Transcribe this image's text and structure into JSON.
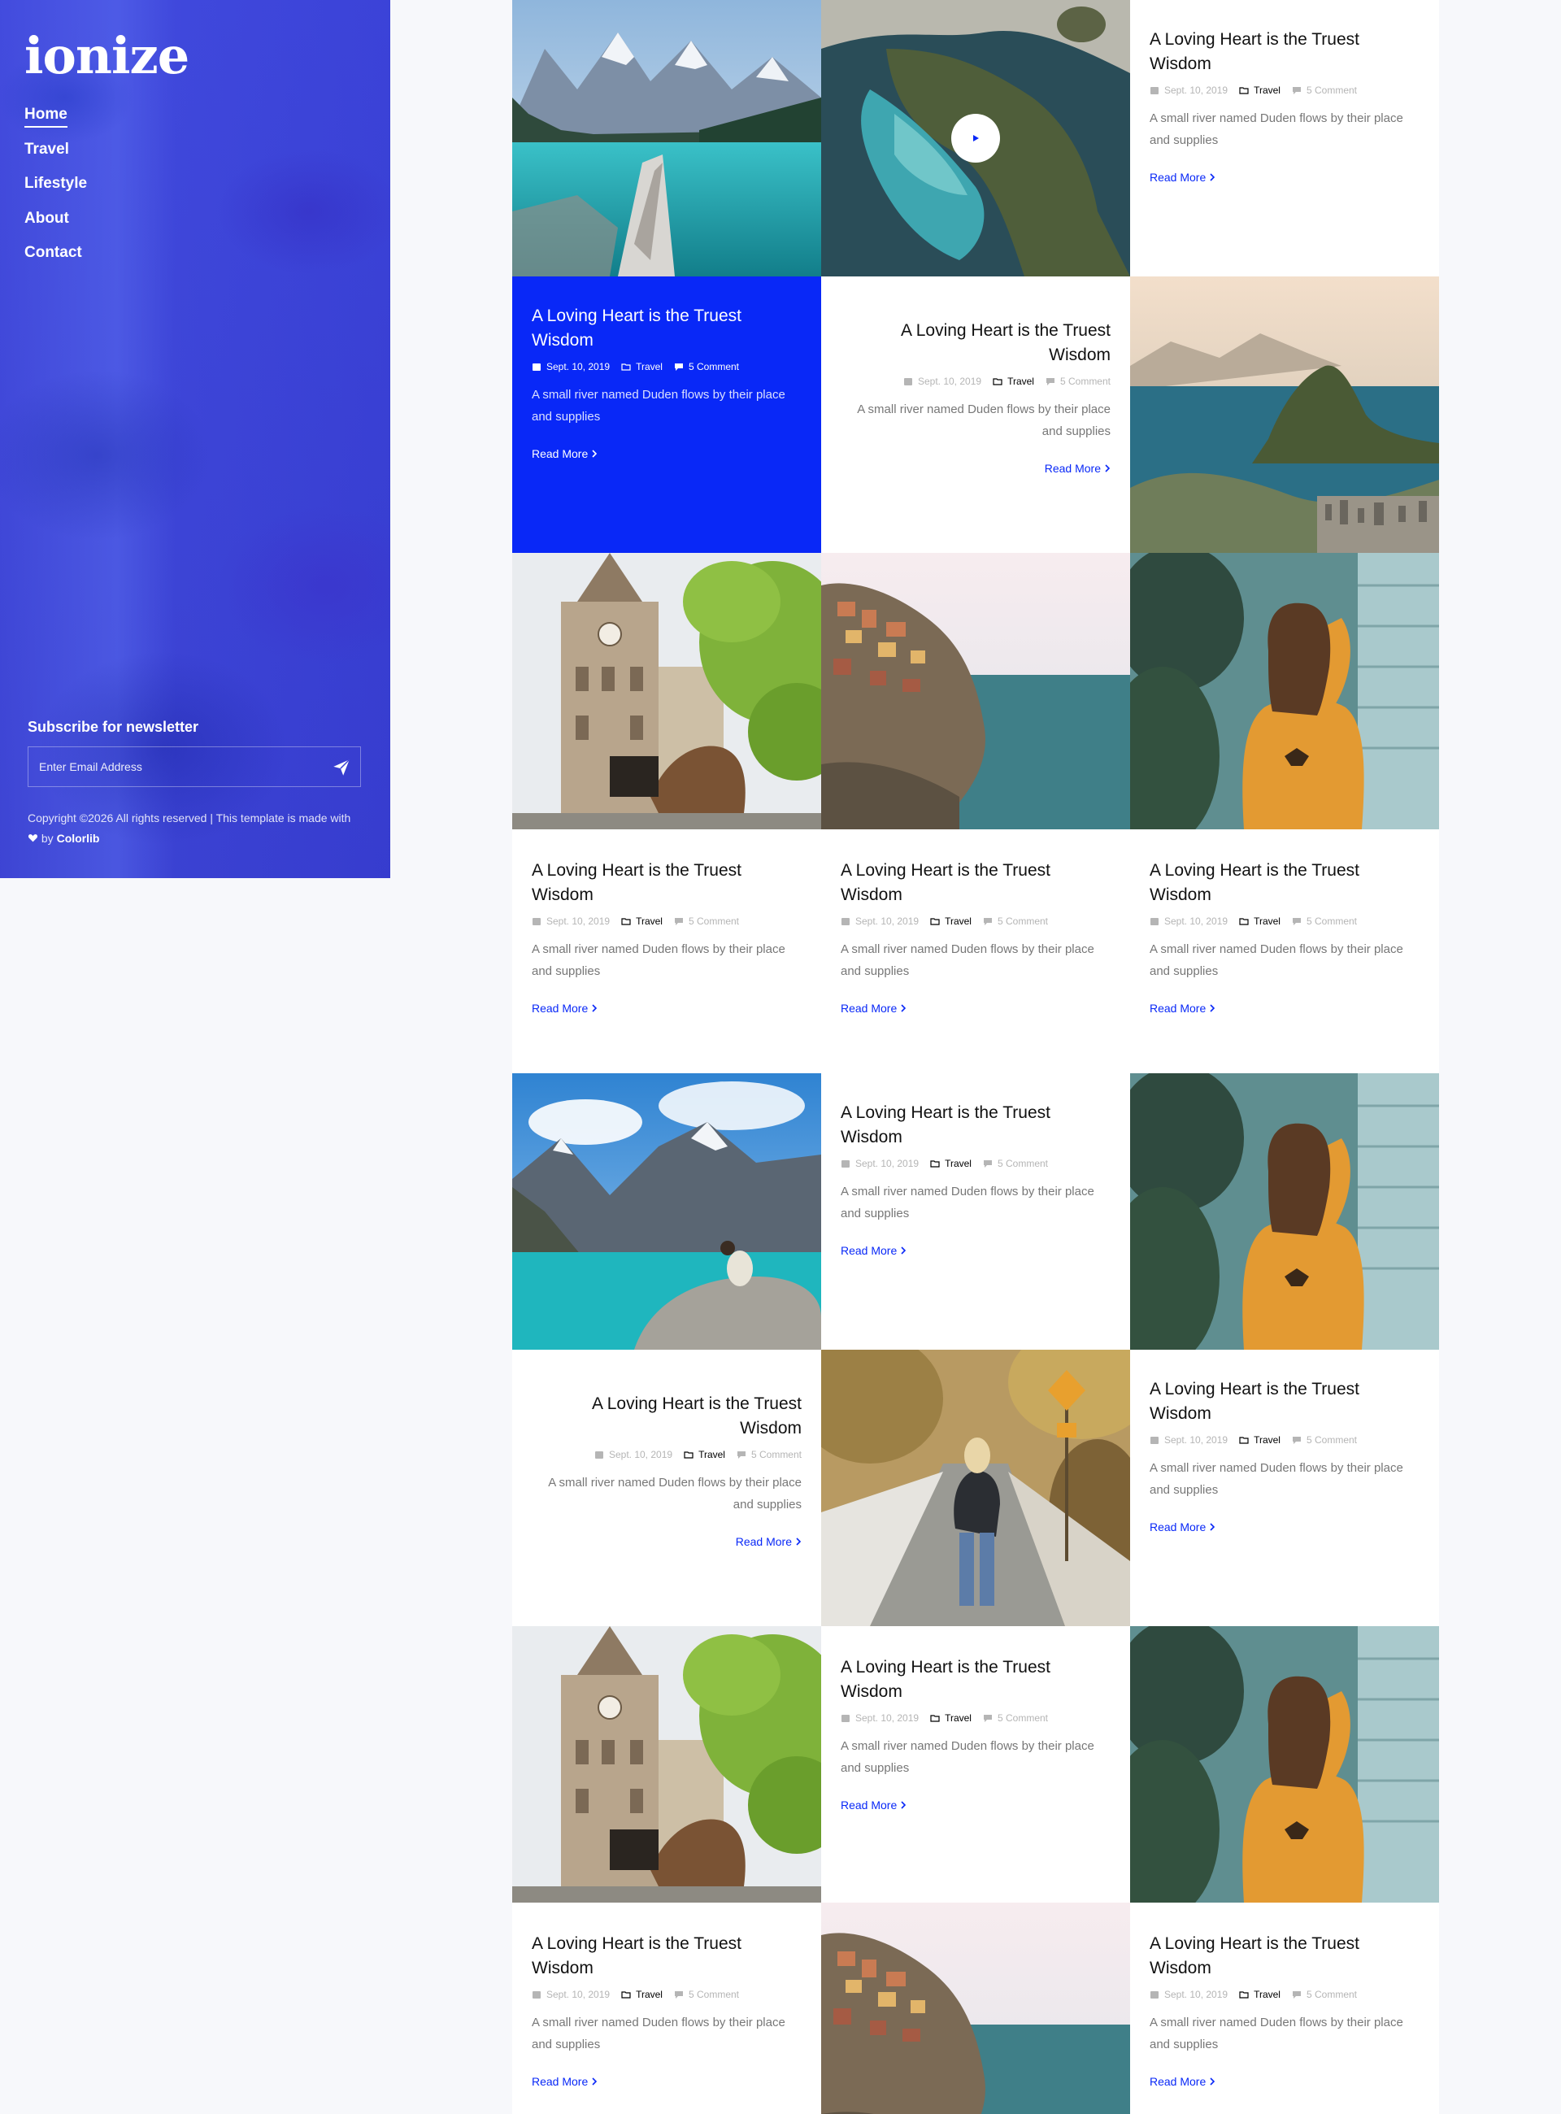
{
  "brand": {
    "logo": "ionize"
  },
  "nav": [
    {
      "label": "Home",
      "active": true
    },
    {
      "label": "Travel"
    },
    {
      "label": "Lifestyle"
    },
    {
      "label": "About"
    },
    {
      "label": "Contact"
    }
  ],
  "newsletter": {
    "title": "Subscribe for newsletter",
    "placeholder": "Enter Email Address",
    "submit_icon": "paper-plane-icon"
  },
  "footer": {
    "copyright_prefix": "Copyright ©2026 All rights reserved | This template is made with",
    "heart_icon": "heart-icon",
    "by": "by",
    "author": "Colorlib"
  },
  "colors": {
    "accent": "#0928f7",
    "sidebar": "#3d44d8"
  },
  "post": {
    "title": "A Loving Heart is the Truest Wisdom",
    "date": "Sept. 10, 2019",
    "category": "Travel",
    "comments": "5 Comment",
    "excerpt": "A small river named Duden flows by their place and supplies",
    "read_more": "Read More"
  },
  "images": [
    "mountain-lake-photo",
    "aerial-coast-video",
    "bay-mountain-photo",
    "clock-tower-carriage-photo",
    "cliff-village-photo",
    "woman-orange-sweater-photo",
    "couple-mountain-lake-photo",
    "woman-orange-sweater-photo",
    "woman-hiking-road-photo",
    "clock-tower-carriage-photo",
    "woman-orange-sweater-photo",
    "cliff-village-photo"
  ],
  "video": {
    "play_icon": "play-icon"
  }
}
